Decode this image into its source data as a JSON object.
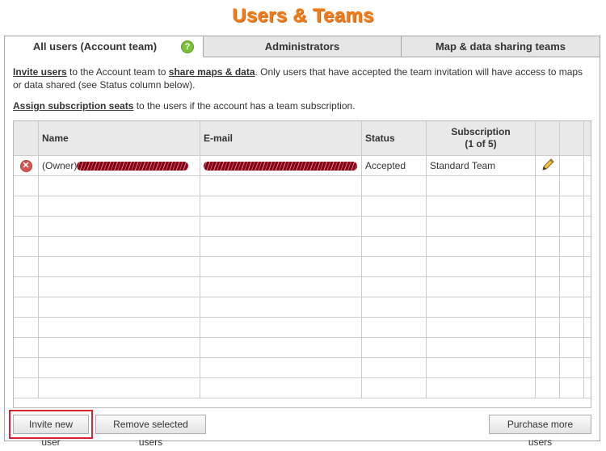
{
  "page": {
    "title": "Users & Teams"
  },
  "tabs": [
    {
      "label": "All users (Account team)",
      "active": true,
      "help_icon": "help-icon"
    },
    {
      "label": "Administrators",
      "active": false
    },
    {
      "label": "Map & data sharing teams",
      "active": false
    }
  ],
  "intro": {
    "invite_link": "Invite users",
    "text1": " to the Account team to ",
    "share_link": "share maps & data",
    "text2": ". Only users that have accepted the team invitation will have access to maps or data shared (see Status column below).",
    "assign_link": "Assign subscription seats",
    "text3": " to the users if the account has a team subscription."
  },
  "table": {
    "headers": {
      "name": "Name",
      "email": "E-mail",
      "status": "Status",
      "subscription_line1": "Subscription",
      "subscription_line2": "(1 of 5)"
    },
    "rows": [
      {
        "name_prefix": "(Owner)",
        "name_redacted": true,
        "email_redacted": true,
        "status": "Accepted",
        "subscription": "Standard Team"
      }
    ]
  },
  "buttons": {
    "invite": "Invite new user",
    "remove": "Remove selected users",
    "purchase": "Purchase more users"
  },
  "colors": {
    "title": "#f07d1a",
    "highlight": "#d9232d",
    "redaction": "#8b0016"
  }
}
